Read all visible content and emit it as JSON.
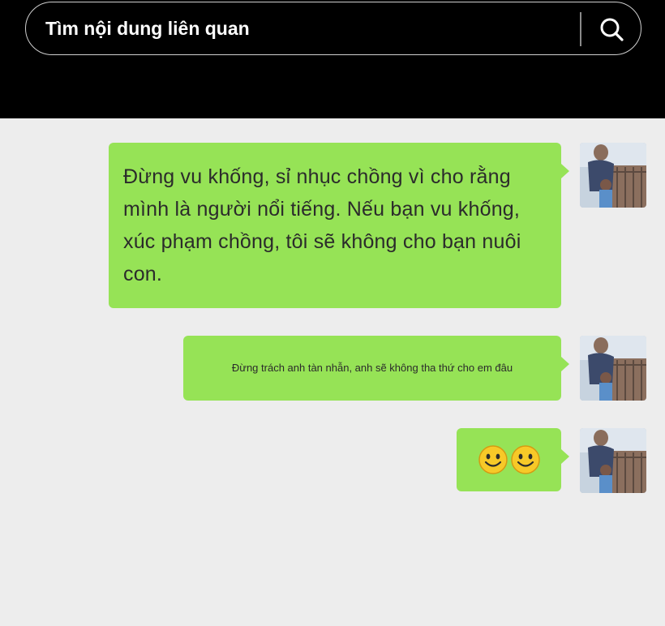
{
  "search": {
    "placeholder": "Tìm nội dung liên quan",
    "icon": "search-icon"
  },
  "messages": [
    {
      "sender": "self",
      "text": "Đừng vu khống, sỉ nhục chồng vì cho rằng mình là người nổi tiếng. Nếu bạn vu khống, xúc phạm chồng, tôi sẽ không cho bạn nuôi con."
    },
    {
      "sender": "self",
      "text": "Đừng trách anh tàn nhẫn, anh sẽ không tha thứ cho em đâu"
    },
    {
      "sender": "self",
      "emoji": [
        "smiley-face-icon",
        "smiley-face-icon"
      ]
    }
  ],
  "colors": {
    "top_bar": "#000000",
    "chat_background": "#ededed",
    "bubble": "#96e356"
  }
}
